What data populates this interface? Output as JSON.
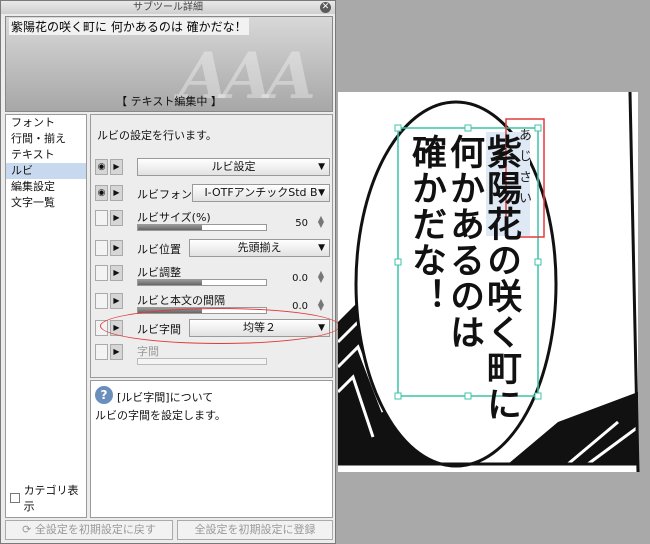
{
  "window": {
    "title": "サブツール詳細",
    "close_glyph": "✕"
  },
  "preview": {
    "text": "紫陽花の咲く町に 何かあるのは 確かだな！",
    "status": "【 テキスト編集中 】",
    "watermark": "AAA"
  },
  "nav": {
    "items": [
      {
        "label": "フォント"
      },
      {
        "label": "行間・揃え"
      },
      {
        "label": "テキスト"
      },
      {
        "label": "ルビ",
        "selected": true
      },
      {
        "label": "編集設定"
      },
      {
        "label": "文字一覧"
      }
    ],
    "category_label": "カテゴリ表示"
  },
  "content": {
    "description": "ルビの設定を行います。",
    "ruby_setting_combo": "ルビ設定",
    "rows": {
      "font": {
        "label": "ルビフォント",
        "value": "I-OTFアンチックStd B"
      },
      "size": {
        "label": "ルビサイズ(%)",
        "value": "50",
        "fraction": 0.5
      },
      "position": {
        "label": "ルビ位置",
        "value": "先頭揃え"
      },
      "adjust": {
        "label": "ルビ調整",
        "value": "0.0",
        "fraction": 0.5
      },
      "gap": {
        "label": "ルビと本文の間隔",
        "value": "0.0",
        "fraction": 0.5
      },
      "spacing": {
        "label": "ルビ字間",
        "value": "均等２"
      },
      "char_gap": {
        "label": "字間"
      }
    }
  },
  "help": {
    "icon": "?",
    "title": "[ルビ字間]について",
    "body": "ルビの字間を設定します。"
  },
  "buttons": {
    "reset": "全設定を初期設定に戻す",
    "register": "全設定を初期設定に登録"
  },
  "canvas": {
    "columns": [
      "紫陽花の咲く町に",
      "何かあるのは",
      "確かだな！"
    ],
    "ruby": "あじさい"
  },
  "colors": {
    "highlight": "#e23a3a",
    "selection": "#c7d9ee",
    "handles": "#3cc4a7"
  }
}
